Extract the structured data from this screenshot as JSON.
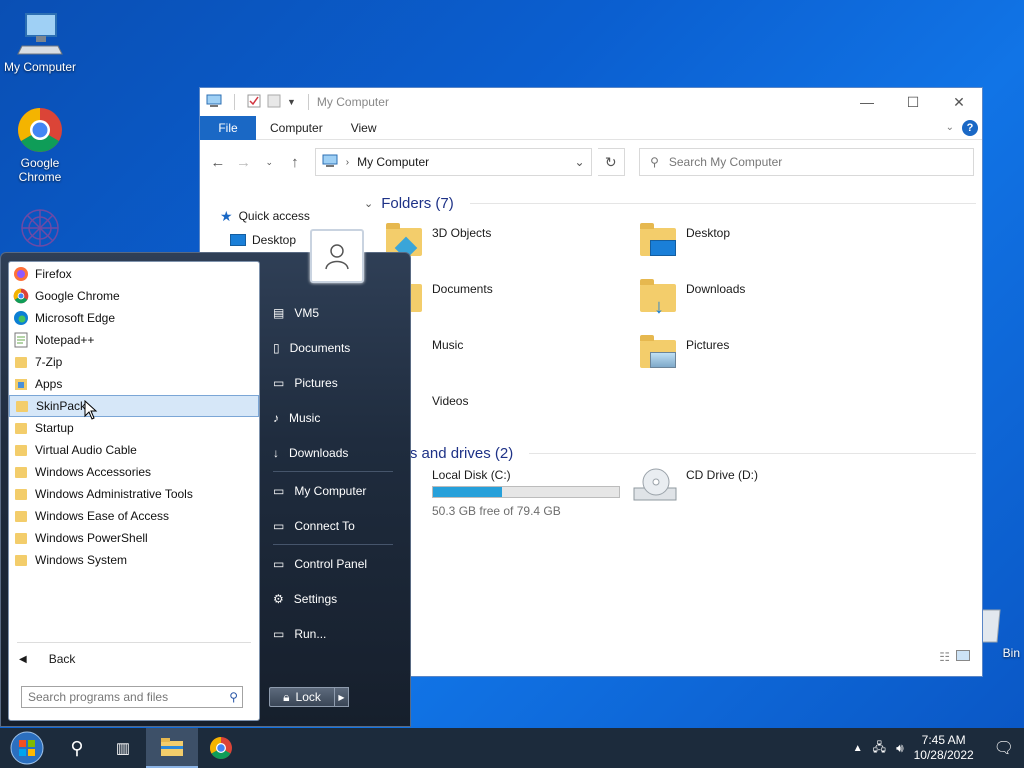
{
  "desktop": {
    "icons": [
      {
        "label": "My Computer"
      },
      {
        "label": "Google Chrome"
      },
      {
        "label": "Bin"
      }
    ]
  },
  "explorer": {
    "title": "My Computer",
    "ribbon_tabs": [
      "File",
      "Computer",
      "View"
    ],
    "address": "My Computer",
    "search_placeholder": "Search My Computer",
    "nav_items": [
      "Quick access",
      "Desktop"
    ],
    "folders_header": "Folders (7)",
    "folders": [
      "3D Objects",
      "Desktop",
      "Documents",
      "Downloads",
      "Music",
      "Pictures",
      "Videos"
    ],
    "drives_header": "ces and drives (2)",
    "drives": [
      {
        "name": "Local Disk (C:)",
        "free": "50.3 GB free of 79.4 GB",
        "used_fraction": 0.37
      },
      {
        "name": "CD Drive (D:)"
      }
    ]
  },
  "start_menu": {
    "programs": [
      "Firefox",
      "Google Chrome",
      "Microsoft Edge",
      "Notepad++",
      "7-Zip",
      "Apps",
      "SkinPack",
      "Startup",
      "Virtual Audio Cable",
      "Windows Accessories",
      "Windows Administrative Tools",
      "Windows Ease of Access",
      "Windows PowerShell",
      "Windows System"
    ],
    "selected": "SkinPack",
    "back_label": "Back",
    "search_placeholder": "Search programs and files",
    "right_items": [
      "VM5",
      "Documents",
      "Pictures",
      "Music",
      "Downloads",
      "My Computer",
      "Connect To",
      "Control Panel",
      "Settings",
      "Run..."
    ],
    "lock_label": "Lock"
  },
  "taskbar": {
    "time": "7:45 AM",
    "date": "10/28/2022"
  },
  "colors": {
    "accent": "#1a68c5",
    "progress": "#26a0da",
    "folder": "#f3cd6b"
  }
}
